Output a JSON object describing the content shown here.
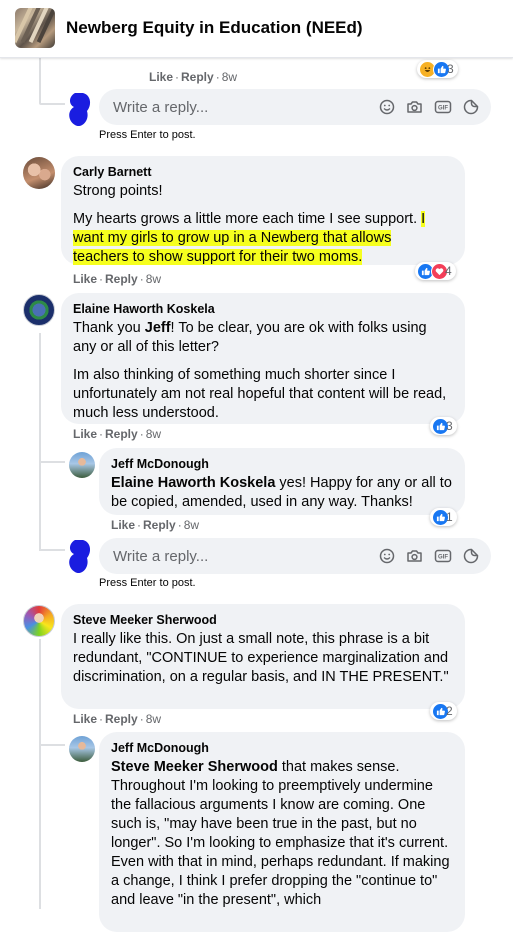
{
  "header": {
    "title": "Newberg Equity in Education (NEEd)"
  },
  "colors": {
    "like_blue": "#1877f2",
    "love_red": "#f33e58",
    "haha_yellow": "#f7b125",
    "highlight": "#f6ff1e",
    "redaction_blue": "#1a1de0"
  },
  "top_reply": {
    "like": "Like",
    "reply": "Reply",
    "time": "8w",
    "reaction_count": "3",
    "reaction_icons": [
      "haha-icon",
      "like-icon"
    ]
  },
  "composer": {
    "placeholder": "Write a reply...",
    "hint": "Press Enter to post.",
    "icons": [
      "emoji-icon",
      "camera-icon",
      "gif-icon",
      "sticker-icon"
    ]
  },
  "comments": [
    {
      "author": "Carly Barnett",
      "line1": "Strong points!",
      "p2_plain": "My hearts grows a little more each time I see support. ",
      "p2_hl1": "I",
      "p2_hl2": "want my girls to grow up in a Newberg that allows",
      "p2_hl3": "teachers to show support for their two moms.",
      "like": "Like",
      "reply": "Reply",
      "time": "8w",
      "reaction_count": "4",
      "reaction_icons": [
        "like-icon",
        "love-icon"
      ]
    },
    {
      "author": "Elaine Haworth Koskela",
      "p1_a": "Thank you ",
      "p1_b": "Jeff",
      "p1_c": "! To be clear, you are ok with folks using any or all of this letter?",
      "p2": "Im also thinking of something much shorter since I unfortunately am not real hopeful that content will be read, much less understood.",
      "like": "Like",
      "reply": "Reply",
      "time": "8w",
      "reaction_count": "3",
      "reply_comment": {
        "author": "Jeff McDonough",
        "mention": "Elaine Haworth Koskela",
        "text": " yes! Happy for any or all to be copied, amended, used in any way. Thanks!",
        "like": "Like",
        "reply": "Reply",
        "time": "8w",
        "reaction_count": "1"
      }
    },
    {
      "author": "Steve Meeker Sherwood",
      "text": "I really like this. On just a small note, this phrase is a bit redundant, \"CONTINUE to experience marginalization and discrimination, on a regular basis, and IN THE PRESENT.\"",
      "like": "Like",
      "reply": "Reply",
      "time": "8w",
      "reaction_count": "2",
      "reply_comment": {
        "author": "Jeff McDonough",
        "mention": "Steve Meeker Sherwood",
        "text": " that makes sense. Throughout I'm looking to preemptively undermine the fallacious arguments I know are coming. One such is, \"may have been true in the past, but no longer\". So I'm looking to emphasize that it's current. Even with that in mind, perhaps redundant. If making a change, I think I prefer dropping the \"continue to\" and leave \"in the present\", which"
      }
    }
  ]
}
